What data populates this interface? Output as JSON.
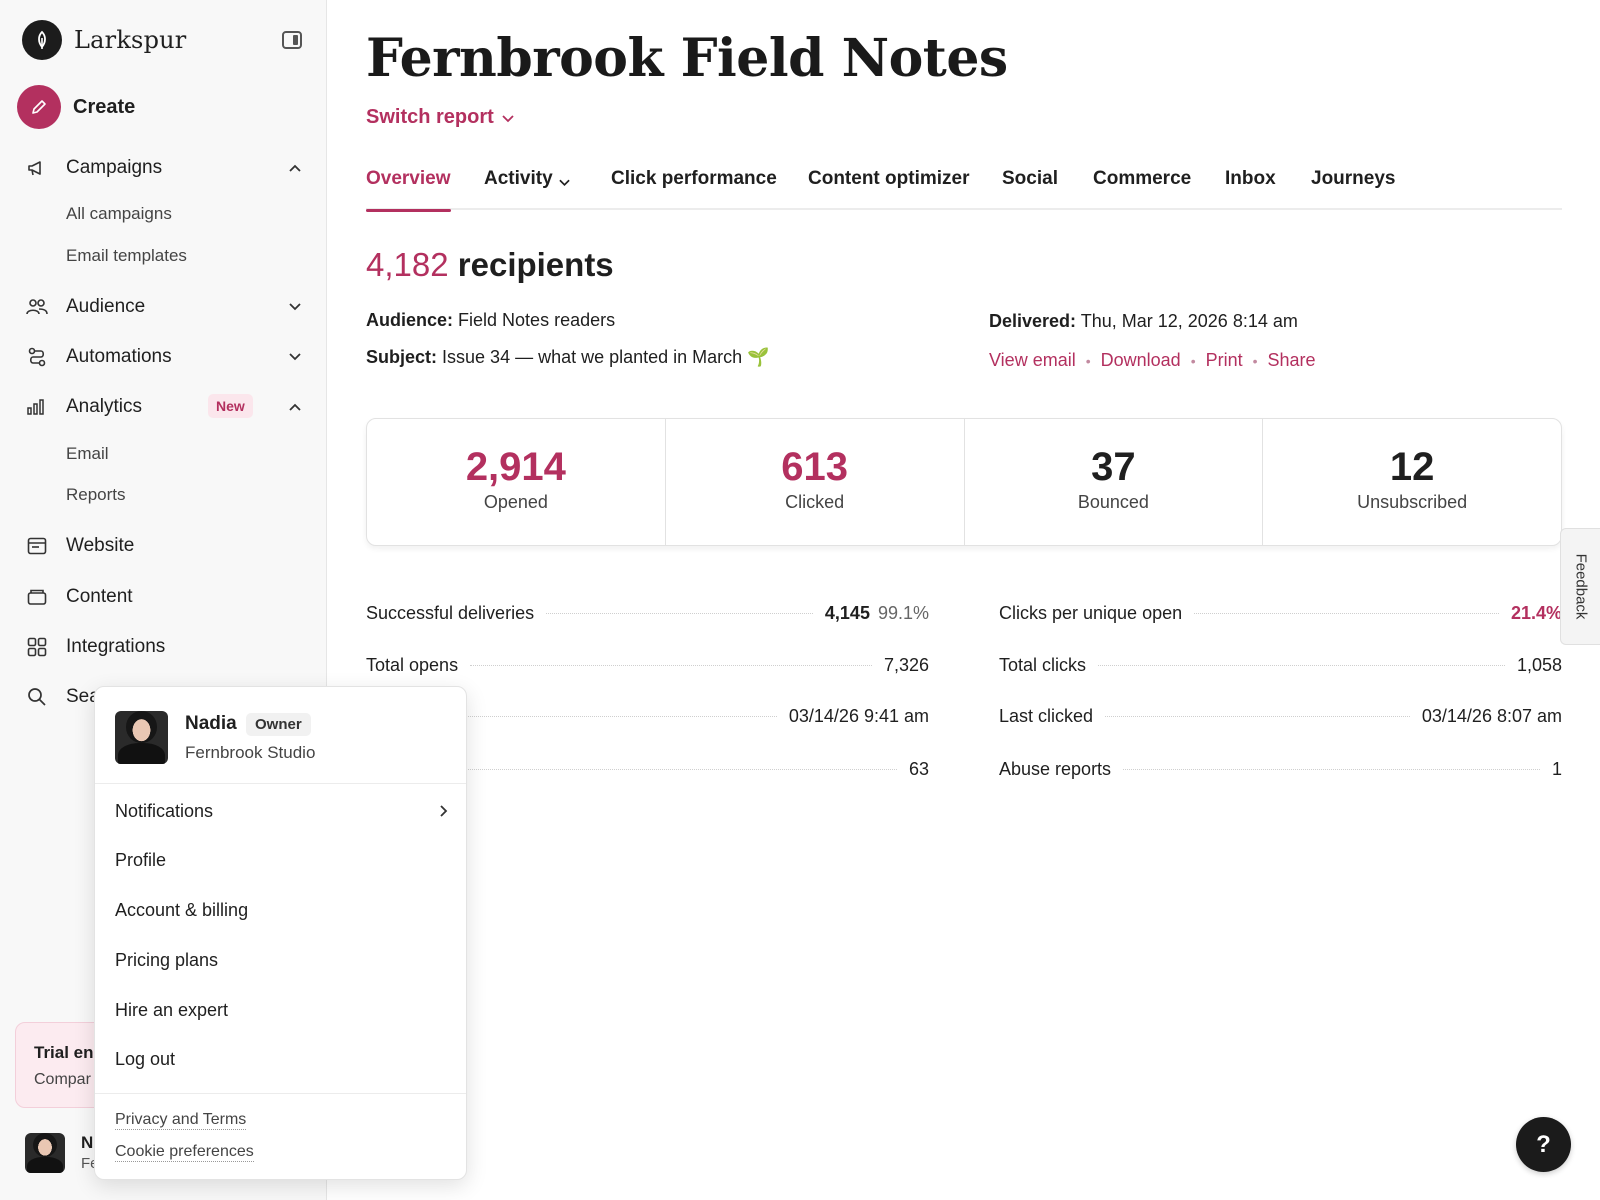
{
  "sidebar": {
    "brand": "Larkspur",
    "create_label": "Create",
    "nav": {
      "campaigns": "Campaigns",
      "all_campaigns": "All campaigns",
      "email_templates": "Email templates",
      "audience": "Audience",
      "automations": "Automations",
      "analytics": "Analytics",
      "analytics_badge": "New",
      "email": "Email",
      "reports": "Reports",
      "website": "Website",
      "content": "Content",
      "integrations": "Integrations",
      "search": "Sea"
    },
    "trial": {
      "title": "Trial en",
      "subtitle": "Compar"
    },
    "user": {
      "initial": "N",
      "org_partial": "Fe"
    }
  },
  "header": {
    "title": "Fernbrook Field Notes",
    "switch_report": "Switch report"
  },
  "tabs": [
    {
      "label": "Overview"
    },
    {
      "label": "Activity"
    },
    {
      "label": "Click performance"
    },
    {
      "label": "Content optimizer"
    },
    {
      "label": "Social"
    },
    {
      "label": "Commerce"
    },
    {
      "label": "Inbox"
    },
    {
      "label": "Journeys"
    }
  ],
  "summary": {
    "recipients_count": "4,182",
    "recipients_word": "recipients",
    "audience_label": "Audience:",
    "audience_value": "Field Notes readers",
    "subject_label": "Subject:",
    "subject_value": "Issue 34 — what we planted in March 🌱",
    "delivered_label": "Delivered:",
    "delivered_value": "Thu, Mar 12, 2026 8:14 am",
    "links": {
      "view_email": "View email",
      "download": "Download",
      "print": "Print",
      "share": "Share"
    }
  },
  "stats": [
    {
      "value": "2,914",
      "label": "Opened"
    },
    {
      "value": "613",
      "label": "Clicked"
    },
    {
      "value": "37",
      "label": "Bounced"
    },
    {
      "value": "12",
      "label": "Unsubscribed"
    }
  ],
  "details_left": [
    {
      "label": "Successful deliveries",
      "value": "4,145",
      "extra": "99.1%"
    },
    {
      "label": "Total opens",
      "value": "7,326"
    },
    {
      "label": "",
      "value": "03/14/26 9:41 am"
    },
    {
      "label": "",
      "value": "63"
    }
  ],
  "details_right": [
    {
      "label": "Clicks per unique open",
      "value": "21.4%"
    },
    {
      "label": "Total clicks",
      "value": "1,058"
    },
    {
      "label": "Last clicked",
      "value": "03/14/26 8:07 am"
    },
    {
      "label": "Abuse reports",
      "value": "1"
    }
  ],
  "feedback_label": "Feedback",
  "help_label": "?",
  "popover": {
    "name": "Nadia",
    "role": "Owner",
    "org": "Fernbrook Studio",
    "items": {
      "notifications": "Notifications",
      "profile": "Profile",
      "account_billing": "Account & billing",
      "pricing_plans": "Pricing plans",
      "hire_expert": "Hire an expert",
      "log_out": "Log out"
    },
    "privacy": "Privacy and Terms",
    "cookies": "Cookie preferences"
  },
  "colors": {
    "accent": "#b3305f",
    "badge_bg": "#fbe6ec",
    "trial_bg": "#fcebf0"
  }
}
